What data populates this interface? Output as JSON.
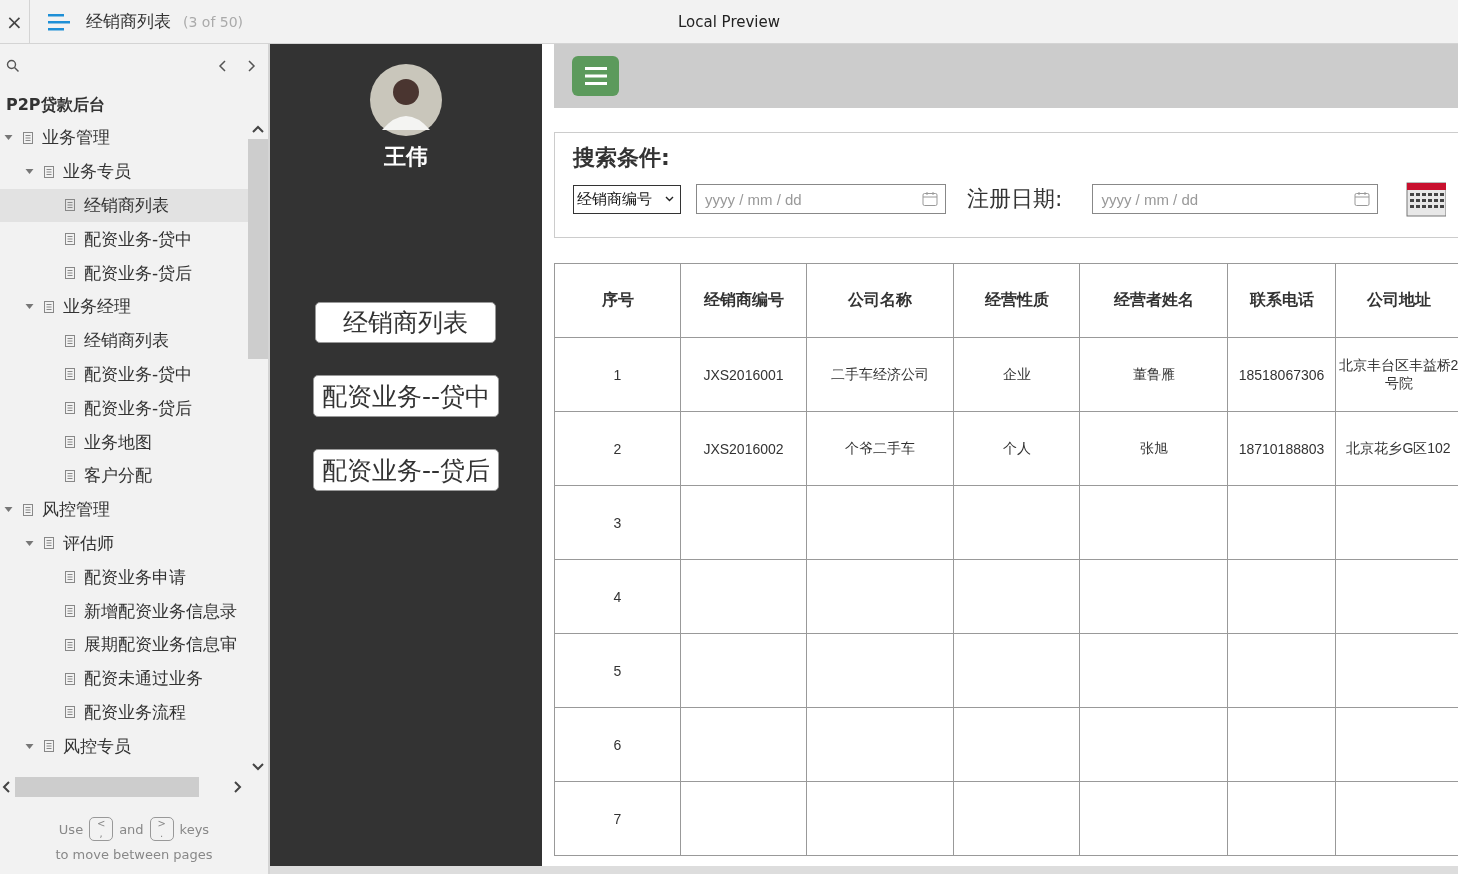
{
  "top_bar": {
    "close": "×",
    "title": "经销商列表",
    "page_count": "(3 of 50)",
    "preview_label": "Local Preview"
  },
  "sidebar": {
    "project": "P2P贷款后台",
    "tree": [
      {
        "label": "业务管理",
        "expanded": true,
        "selected": false,
        "children": [
          {
            "label": "业务专员",
            "expanded": true,
            "selected": false,
            "children": [
              {
                "label": "经销商列表",
                "selected": true
              },
              {
                "label": "配资业务-贷中",
                "selected": false
              },
              {
                "label": "配资业务-贷后",
                "selected": false
              }
            ]
          },
          {
            "label": "业务经理",
            "expanded": true,
            "selected": false,
            "children": [
              {
                "label": "经销商列表",
                "selected": false
              },
              {
                "label": "配资业务-贷中",
                "selected": false
              },
              {
                "label": "配资业务-贷后",
                "selected": false
              },
              {
                "label": "业务地图",
                "selected": false
              },
              {
                "label": "客户分配",
                "selected": false
              }
            ]
          }
        ]
      },
      {
        "label": "风控管理",
        "expanded": true,
        "selected": false,
        "children": [
          {
            "label": "评估师",
            "expanded": true,
            "selected": false,
            "children": [
              {
                "label": "配资业务申请",
                "selected": false
              },
              {
                "label": "新增配资业务信息录",
                "selected": false
              },
              {
                "label": "展期配资业务信息审",
                "selected": false
              },
              {
                "label": "配资未通过业务",
                "selected": false
              },
              {
                "label": "配资业务流程",
                "selected": false
              }
            ]
          },
          {
            "label": "风控专员",
            "expanded": true,
            "selected": false
          }
        ]
      }
    ],
    "hint": {
      "use": "Use",
      "prev_key": {
        "top": "<",
        "bottom": ","
      },
      "and": "and",
      "next_key": {
        "top": ">",
        "bottom": "."
      },
      "keys": "keys",
      "line2": "to move between pages"
    }
  },
  "nav_panel": {
    "user_name": "王伟",
    "buttons": [
      "经销商列表",
      "配资业务--贷中",
      "配资业务--贷后"
    ]
  },
  "search": {
    "title": "搜索条件:",
    "select_value": "经销商编号",
    "date_placeholder_1": "yyyy / mm / dd",
    "date_label": "注册日期:",
    "date_placeholder_2": "yyyy / mm / dd"
  },
  "table": {
    "columns": [
      "序号",
      "经销商编号",
      "公司名称",
      "经营性质",
      "经营者姓名",
      "联系电话",
      "公司地址"
    ],
    "rows": [
      [
        "1",
        "JXS2016001",
        "二手车经济公司",
        "企业",
        "董鲁雁",
        "18518067306",
        "北京丰台区丰益桥2号院"
      ],
      [
        "2",
        "JXS2016002",
        "个爷二手车",
        "个人",
        "张旭",
        "18710188803",
        "北京花乡G区102"
      ],
      [
        "3",
        "",
        "",
        "",
        "",
        "",
        ""
      ],
      [
        "4",
        "",
        "",
        "",
        "",
        "",
        ""
      ],
      [
        "5",
        "",
        "",
        "",
        "",
        "",
        ""
      ],
      [
        "6",
        "",
        "",
        "",
        "",
        "",
        ""
      ],
      [
        "7",
        "",
        "",
        "",
        "",
        "",
        ""
      ]
    ]
  }
}
